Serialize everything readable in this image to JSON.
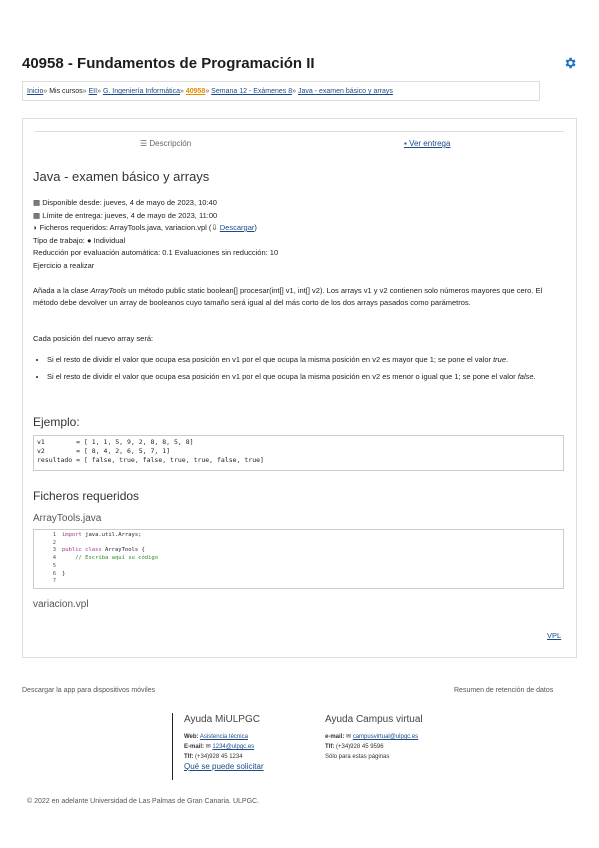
{
  "page": {
    "title": "40958 - Fundamentos de Programación II",
    "icons": {
      "settings": "gear-icon"
    }
  },
  "breadcrumb": {
    "items": [
      "Inicio",
      "Mis cursos",
      "EII",
      "G. Ingeniería Informática",
      "40958",
      "Semana 12 - Exámenes 8",
      "Java - examen básico y arrays"
    ],
    "separator": "»"
  },
  "tabs": {
    "description": "Descripción",
    "view_submission": "Ver entrega"
  },
  "activity": {
    "heading": "Java - examen básico y arrays",
    "available_from": "Disponible desde: jueves, 4 de mayo de 2023, 10:40",
    "due_date": "Límite de entrega: jueves, 4 de mayo de 2023, 11:00",
    "required_files_prefix": "Ficheros requeridos: ArrayTools.java, variacion.vpl (",
    "download_label": "Descargar",
    "required_files_suffix": ")",
    "work_type_prefix": "Tipo de trabajo:",
    "work_type_value": "Individual",
    "reduction": "Reducción por evaluación automática: 0.1 Evaluaciones sin reducción: 10",
    "exercise": "Ejercicio a realizar",
    "desc_part1": "Añada a la clase ",
    "desc_class": "ArrayTools",
    "desc_part2": " un método public static boolean[] procesar(int[] v1, int[] v2). Los arrays v1 y v2 contienen solo números mayores que cero. El método debe devolver un array de booleanos cuyo tamaño será igual al del más corto de los dos arrays pasados como parámetros.",
    "each_position": "Cada posición del nuevo array será:",
    "rule1_text": "Si el resto de dividir el valor que ocupa esa posición en v1 por el que ocupa la misma posición en v2 es mayor que 1; se pone el valor ",
    "rule1_value": "true",
    "rule1_end": ".",
    "rule2_text": "Si el resto de dividir el valor que ocupa esa posición en v1 por el que ocupa la misma posición en v2 es menor o igual que 1; se pone el valor ",
    "rule2_value": "false",
    "rule2_end": ".",
    "example_heading": "Ejemplo:",
    "example_code": "v1        = [ 1, 1, 5, 9, 2, 8, 8, 5, 8]\nv2        = [ 8, 4, 2, 6, 5, 7, 1]\nresultado = [ false, true, false, true, true, false, true]"
  },
  "required_files": {
    "heading": "Ficheros requeridos",
    "file1_name": "ArrayTools.java",
    "code_lines": [
      {
        "n": "1",
        "kw": "import",
        "rest": " java.util.Arrays;"
      },
      {
        "n": "2",
        "kw": "",
        "rest": ""
      },
      {
        "n": "3",
        "kw": "public class",
        "rest": " ArrayTools {"
      },
      {
        "n": "4",
        "kw": "",
        "rest": "    ",
        "comment": "// Escriba aquí su código"
      },
      {
        "n": "5",
        "kw": "",
        "rest": ""
      },
      {
        "n": "6",
        "kw": "",
        "rest": "}"
      },
      {
        "n": "7",
        "kw": "",
        "rest": ""
      }
    ],
    "file2_name": "variacion.vpl",
    "vpl_link": "VPL"
  },
  "footer": {
    "mobile_app": "Descargar la app para dispositivos móviles",
    "data_retention": "Resumen de retención de datos",
    "help_miulpgc": {
      "heading": "Ayuda MiULPGC",
      "web_label": "Web:",
      "web_link": "Asistencia técnica",
      "email_label": "E-mail:",
      "email_link": "1234@ulpgc.es",
      "phone_label": "Tlf:",
      "phone_value": "(+34)928 45 1234",
      "request_link": "Qué se puede solicitar"
    },
    "help_campus": {
      "heading": "Ayuda Campus virtual",
      "email_label": "e-mail:",
      "email_link": "campusvirtual@ulpgc.es",
      "phone_label": "Tlf:",
      "phone_value": "(+34)928 45 9596",
      "note": "Sólo para estas páginas"
    },
    "copyright": "© 2022 en adelante Universidad de Las Palmas de Gran Canaria. ULPGC."
  }
}
